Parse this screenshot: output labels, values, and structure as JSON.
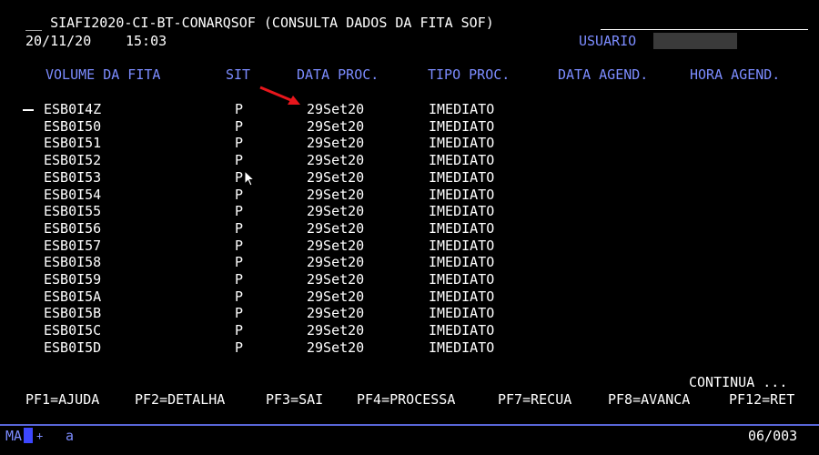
{
  "header": {
    "title": "__ SIAFI2020-CI-BT-CONARQSOF (CONSULTA DADOS DA FITA SOF)",
    "date": "20/11/20",
    "time": "15:03",
    "user_label": "USUARIO"
  },
  "columns": [
    "VOLUME DA FITA",
    "SIT",
    "DATA PROC.",
    "TIPO PROC.",
    "DATA AGEND.",
    "HORA AGEND."
  ],
  "rows": [
    {
      "volume": "ESB0I4Z",
      "sit": "P",
      "data_proc": "29Set20",
      "tipo_proc": "IMEDIATO"
    },
    {
      "volume": "ESB0I50",
      "sit": "P",
      "data_proc": "29Set20",
      "tipo_proc": "IMEDIATO"
    },
    {
      "volume": "ESB0I51",
      "sit": "P",
      "data_proc": "29Set20",
      "tipo_proc": "IMEDIATO"
    },
    {
      "volume": "ESB0I52",
      "sit": "P",
      "data_proc": "29Set20",
      "tipo_proc": "IMEDIATO"
    },
    {
      "volume": "ESB0I53",
      "sit": "P",
      "data_proc": "29Set20",
      "tipo_proc": "IMEDIATO"
    },
    {
      "volume": "ESB0I54",
      "sit": "P",
      "data_proc": "29Set20",
      "tipo_proc": "IMEDIATO"
    },
    {
      "volume": "ESB0I55",
      "sit": "P",
      "data_proc": "29Set20",
      "tipo_proc": "IMEDIATO"
    },
    {
      "volume": "ESB0I56",
      "sit": "P",
      "data_proc": "29Set20",
      "tipo_proc": "IMEDIATO"
    },
    {
      "volume": "ESB0I57",
      "sit": "P",
      "data_proc": "29Set20",
      "tipo_proc": "IMEDIATO"
    },
    {
      "volume": "ESB0I58",
      "sit": "P",
      "data_proc": "29Set20",
      "tipo_proc": "IMEDIATO"
    },
    {
      "volume": "ESB0I59",
      "sit": "P",
      "data_proc": "29Set20",
      "tipo_proc": "IMEDIATO"
    },
    {
      "volume": "ESB0I5A",
      "sit": "P",
      "data_proc": "29Set20",
      "tipo_proc": "IMEDIATO"
    },
    {
      "volume": "ESB0I5B",
      "sit": "P",
      "data_proc": "29Set20",
      "tipo_proc": "IMEDIATO"
    },
    {
      "volume": "ESB0I5C",
      "sit": "P",
      "data_proc": "29Set20",
      "tipo_proc": "IMEDIATO"
    },
    {
      "volume": "ESB0I5D",
      "sit": "P",
      "data_proc": "29Set20",
      "tipo_proc": "IMEDIATO"
    }
  ],
  "continua": "CONTINUA ...",
  "pf_keys": [
    {
      "label": "PF1=AJUDA"
    },
    {
      "label": "PF2=DETALHA"
    },
    {
      "label": "PF3=SAI"
    },
    {
      "label": "PF4=PROCESSA"
    },
    {
      "label": "PF7=RECUA"
    },
    {
      "label": "PF8=AVANCA"
    },
    {
      "label": "PF12=RET"
    }
  ],
  "status": {
    "mode": "MA",
    "plus": "+",
    "input": "a",
    "position": "06/003"
  },
  "colors": {
    "background": "#000000",
    "text": "#ffffff",
    "header_blue": "#7c8cff",
    "arrow": "#e8161c"
  }
}
